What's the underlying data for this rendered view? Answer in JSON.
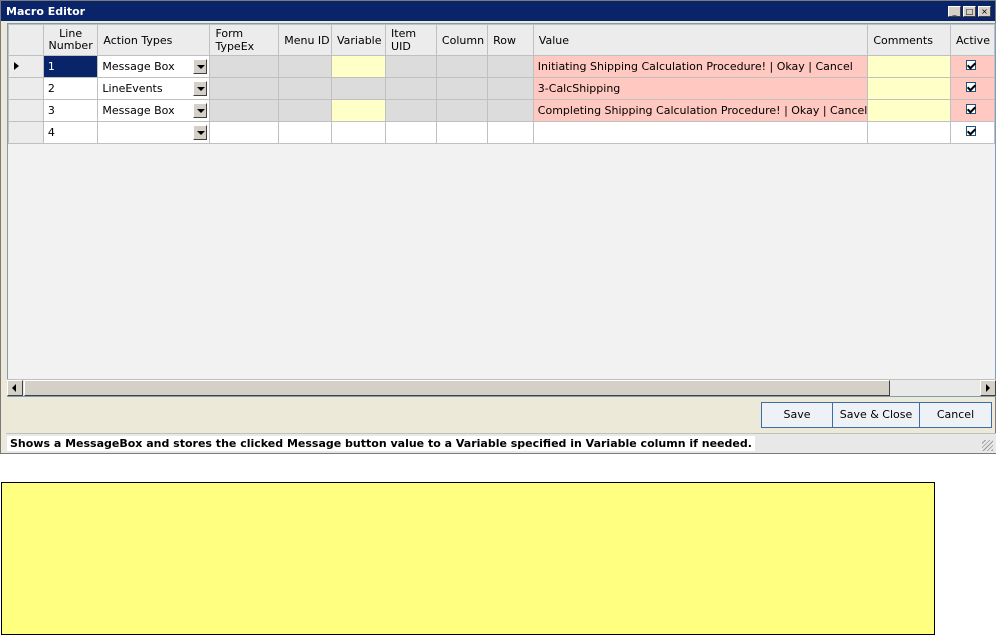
{
  "window": {
    "title": "Macro Editor",
    "controls": {
      "minimize": "_",
      "maximize": "□",
      "close": "×"
    }
  },
  "grid": {
    "columns": [
      "Line Number",
      "Action Types",
      "Form TypeEx",
      "Menu ID",
      "Variable",
      "Item UID",
      "Column",
      "Row",
      "Value",
      "Comments",
      "Active"
    ],
    "rows": [
      {
        "line": "1",
        "action": "Message Box",
        "value": "Initiating Shipping Calculation Procedure! | Okay | Cancel",
        "active": true
      },
      {
        "line": "2",
        "action": "LineEvents",
        "value": "3-CalcShipping",
        "active": true
      },
      {
        "line": "3",
        "action": "Message Box",
        "value": "Completing Shipping Calculation Procedure! | Okay | Cancel",
        "active": true
      },
      {
        "line": "4",
        "action": "",
        "value": "",
        "active": true
      }
    ]
  },
  "buttons": {
    "save": "Save",
    "save_close": "Save & Close",
    "cancel": "Cancel"
  },
  "status": {
    "message": "Shows a MessageBox and  stores the clicked Message button value to a Variable specified in Variable column if needed."
  }
}
